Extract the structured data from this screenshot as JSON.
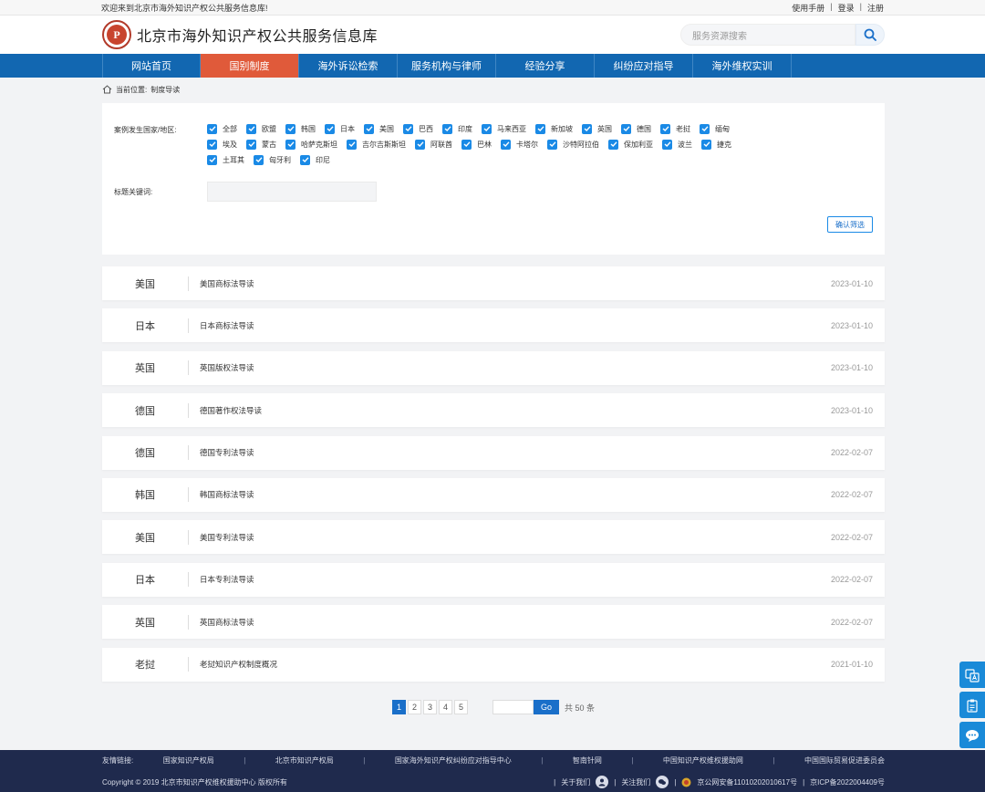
{
  "topbar": {
    "welcome": "欢迎来到北京市海外知识产权公共服务信息库!",
    "manual": "使用手册",
    "sep": "|",
    "login": "登录",
    "register": "注册"
  },
  "header": {
    "logo_letter": "P",
    "title": "北京市海外知识产权公共服务信息库",
    "search_placeholder": "服务资源搜索"
  },
  "nav": {
    "items": [
      "网站首页",
      "国别制度",
      "海外诉讼检索",
      "服务机构与律师",
      "经验分享",
      "纠纷应对指导",
      "海外维权实训"
    ]
  },
  "breadcrumb": {
    "prefix": "当前位置:",
    "current": "制度导读"
  },
  "filter": {
    "country_label": "案例发生国家/地区:",
    "countries": [
      "全部",
      "欧盟",
      "韩国",
      "日本",
      "美国",
      "巴西",
      "印度",
      "马来西亚",
      "新加坡",
      "英国",
      "德国",
      "老挝",
      "缅甸",
      "埃及",
      "蒙古",
      "哈萨克斯坦",
      "吉尔吉斯斯坦",
      "阿联酋",
      "巴林",
      "卡塔尔",
      "沙特阿拉伯",
      "保加利亚",
      "波兰",
      "捷克",
      "土耳其",
      "匈牙利",
      "印尼"
    ],
    "keyword_label": "标题关键词:",
    "keyword_value": "",
    "confirm": "确认筛选"
  },
  "list": [
    {
      "country": "美国",
      "title": "美国商标法导读",
      "date": "2023-01-10"
    },
    {
      "country": "日本",
      "title": "日本商标法导读",
      "date": "2023-01-10"
    },
    {
      "country": "英国",
      "title": "英国版权法导读",
      "date": "2023-01-10"
    },
    {
      "country": "德国",
      "title": "德国著作权法导读",
      "date": "2023-01-10"
    },
    {
      "country": "德国",
      "title": "德国专利法导读",
      "date": "2022-02-07"
    },
    {
      "country": "韩国",
      "title": "韩国商标法导读",
      "date": "2022-02-07"
    },
    {
      "country": "美国",
      "title": "美国专利法导读",
      "date": "2022-02-07"
    },
    {
      "country": "日本",
      "title": "日本专利法导读",
      "date": "2022-02-07"
    },
    {
      "country": "英国",
      "title": "英国商标法导读",
      "date": "2022-02-07"
    },
    {
      "country": "老挝",
      "title": "老挝知识产权制度概况",
      "date": "2021-01-10"
    }
  ],
  "pager": {
    "pages": [
      "1",
      "2",
      "3",
      "4",
      "5"
    ],
    "current": "1",
    "go": "Go",
    "total": "共 50 条"
  },
  "footer": {
    "links_label": "友情链接:",
    "links": [
      "国家知识产权局",
      "北京市知识产权局",
      "国家海外知识产权纠纷应对指导中心",
      "智南针网",
      "中国知识产权维权援助网",
      "中国国际贸易促进委员会"
    ],
    "sep": "|",
    "copyright": "Copyright © 2019 北京市知识产权维权援助中心 版权所有",
    "about": "关于我们",
    "follow": "关注我们",
    "police": "京公网安备11010202010617号",
    "icp": "京ICP备2022004409号"
  },
  "colors": {
    "nav": "#1267b1",
    "nav_active": "#e05a3a",
    "checkbox": "#1a8ae6",
    "footer": "#1f2a4d"
  }
}
